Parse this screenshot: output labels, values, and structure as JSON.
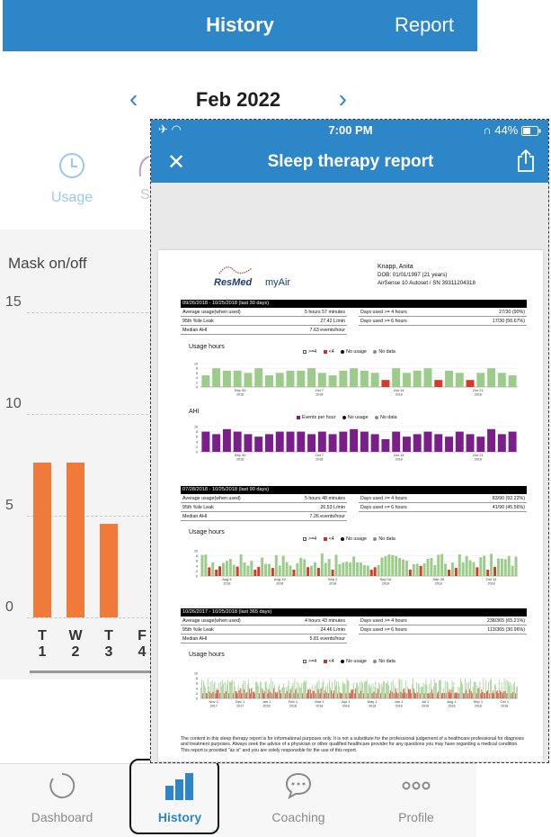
{
  "app": {
    "header_title": "History",
    "header_action": "Report",
    "month": "Feb 2022",
    "tabs": {
      "usage": "Usage",
      "score_partial": "S"
    },
    "chart": {
      "title": "Mask on/off",
      "yticks": [
        "15",
        "10",
        "5",
        "0"
      ],
      "days": [
        {
          "letter": "T",
          "num": "1",
          "hours": 7.6
        },
        {
          "letter": "W",
          "num": "2",
          "hours": 7.6
        },
        {
          "letter": "T",
          "num": "3",
          "hours": 4.6
        },
        {
          "letter": "F",
          "num": "4",
          "hours": 0
        }
      ]
    },
    "bottom_tabs": [
      "Dashboard",
      "History",
      "Coaching",
      "Profile"
    ]
  },
  "overlay": {
    "status": {
      "time": "7:00 PM",
      "battery": "44%"
    },
    "nav_title": "Sleep therapy report",
    "report": {
      "patient_name": "Knapp, Anita",
      "dob": "DOB: 01/01/1997 (21 years)",
      "device": "AirSense 10 Autoset / SN 39311204318",
      "brand": "ResMed",
      "product": "myAir",
      "sections": [
        {
          "header": "09/26/2018 - 10/25/2018 (last 30 days)",
          "avg_usage_label": "Average usage(when used)",
          "avg_usage": "5 hours 57 minutes",
          "leak_label": "95th %ile Leak",
          "leak": "27.42 L/min",
          "ahi_label": "Median AHI",
          "ahi": "7.63 events/hour",
          "days4_label": "Days used >= 4 hours",
          "days4": "27/30 (90%)",
          "days6_label": "Days used >= 6 hours",
          "days6": "17/30 (56.67%)"
        },
        {
          "header": "07/28/2018 - 10/25/2018 (last 90 days)",
          "avg_usage_label": "Average usage(when used)",
          "avg_usage": "5 hours 48 minutes",
          "leak_label": "95th %ile Leak",
          "leak": "26.53 L/min",
          "ahi_label": "Median AHI",
          "ahi": "7.26 events/hour",
          "days4_label": "Days used >= 4 hours",
          "days4": "83/90 (92.22%)",
          "days6_label": "Days used >= 6 hours",
          "days6": "41/90 (45.56%)"
        },
        {
          "header": "10/26/2017 - 10/25/2018 (last 365 days)",
          "avg_usage_label": "Average usage(when used)",
          "avg_usage": "4 hours 43 minutes",
          "leak_label": "95th %ile Leak",
          "leak": "24.46 L/min",
          "ahi_label": "Median AHI",
          "ahi": "5.81 events/hour",
          "days4_label": "Days used >= 4 hours",
          "days4": "238/365 (65.21%)",
          "days6_label": "Days used >= 6 hours",
          "days6": "113/365 (30.96%)"
        }
      ],
      "charts": {
        "usage_title": "Usage hours",
        "ahi_title": "AHI",
        "legend_ge4": ">=4",
        "legend_lt4": "<4",
        "legend_no_usage": "No usage",
        "legend_no_data": "No data",
        "legend_events": "Events per hour",
        "c30_dates": [
          "Sep 30",
          "Oct 7",
          "Oct 14",
          "Oct 21"
        ],
        "c90_dates": [
          "Aug 5",
          "Aug 19",
          "Sep 2",
          "Sep 16",
          "Sep 30",
          "Oct 14"
        ],
        "c365_dates": [
          "Nov 1",
          "Dec 1",
          "Jan 1",
          "Feb 1",
          "Mar 1",
          "Apr 1",
          "May 1",
          "Jun 1",
          "Jul 1",
          "Aug 1",
          "Sep 1",
          "Oct 1"
        ],
        "year_2018": "2018",
        "year_2017": "2017",
        "usage_30": [
          5,
          8,
          7,
          7,
          6,
          8,
          5,
          6,
          7,
          7,
          8,
          6,
          5,
          7,
          8,
          7,
          6,
          3,
          8,
          6,
          7,
          8,
          3,
          7,
          6,
          3,
          6,
          8,
          6,
          5
        ],
        "ahi_30": [
          8,
          7,
          9,
          8,
          7,
          6,
          7,
          8,
          8,
          8,
          7,
          8,
          7,
          8,
          9,
          8,
          7,
          5,
          8,
          6,
          7,
          8,
          7,
          6,
          8,
          7,
          6,
          9,
          7,
          8
        ]
      },
      "disclaimer": "The content in this sleep therapy report is for informational purposes only. It is not a substitute for the professional judgement of a healthcare professional for diagnosis and treatment purposes. Always seek the advice of a physician or other qualified healthcare provider for any questions you may have regarding a medical condition. This report is provided \"as is\" and you are solely responsible for the use of this report."
    }
  }
}
